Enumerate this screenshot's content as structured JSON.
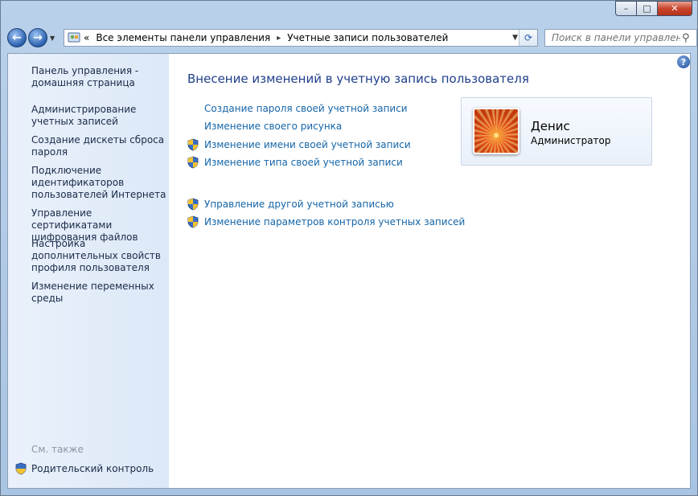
{
  "titlebar": {
    "minimize": "–",
    "maximize": "□",
    "close": "✕"
  },
  "nav": {
    "back": "←",
    "forward": "→"
  },
  "address": {
    "chevron": "«",
    "crumbs": [
      "Все элементы панели управления",
      "Учетные записи пользователей"
    ],
    "sep": "▸"
  },
  "search": {
    "placeholder": "Поиск в панели управления"
  },
  "sidebar": {
    "items": [
      {
        "label": "Панель управления - домашняя страница"
      },
      {
        "label": "Администрирование учетных записей"
      },
      {
        "label": "Создание дискеты сброса пароля"
      },
      {
        "label": "Подключение идентификаторов пользователей Интернета"
      },
      {
        "label": "Управление сертификатами шифрования файлов"
      },
      {
        "label": "Настройка дополнительных свойств профиля пользователя"
      },
      {
        "label": "Изменение переменных среды"
      }
    ],
    "see_also": "См. также",
    "parental": "Родительский контроль"
  },
  "main": {
    "heading": "Внесение изменений в учетную запись пользователя",
    "tasks": [
      {
        "label": "Создание пароля своей учетной записи"
      },
      {
        "label": "Изменение своего рисунка"
      },
      {
        "label": "Изменение имени своей учетной записи"
      },
      {
        "label": "Изменение типа своей учетной записи"
      },
      {
        "label": "Управление другой учетной записью"
      },
      {
        "label": "Изменение параметров контроля учетных записей"
      }
    ],
    "help": "?"
  },
  "user": {
    "name": "Денис",
    "role": "Администратор"
  },
  "icons": {
    "shield": "uac-shield-icon",
    "help": "help-icon",
    "search": "search-icon",
    "refresh": "refresh-icon",
    "control_panel": "control-panel-icon"
  }
}
